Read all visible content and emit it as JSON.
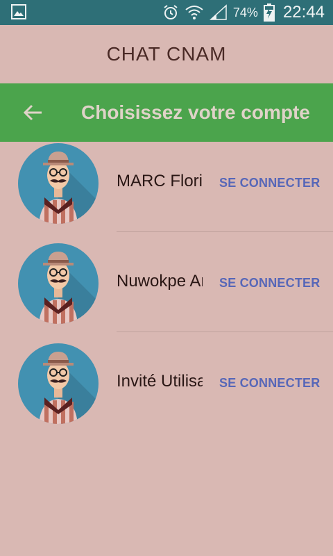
{
  "status_bar": {
    "battery_percent": "74%",
    "time": "22:44",
    "icons": [
      "gallery-notification-icon",
      "alarm-icon",
      "wifi-icon",
      "cell-signal-icon",
      "battery-charging-icon"
    ]
  },
  "app": {
    "title": "CHAT CNAM"
  },
  "toolbar": {
    "title": "Choisissez votre compte",
    "back_icon": "arrow-back-icon",
    "background": "#4ba44c"
  },
  "accounts": [
    {
      "name": "MARC Floria",
      "action_label": "SE CONNECTER"
    },
    {
      "name": "Nuwokpe Ar",
      "action_label": "SE CONNECTER"
    },
    {
      "name": "Invité Utilisa",
      "action_label": "SE CONNECTER"
    }
  ],
  "colors": {
    "background": "#d9b8b3",
    "status_bar": "#2e6f77",
    "action_text": "#5767b8"
  }
}
